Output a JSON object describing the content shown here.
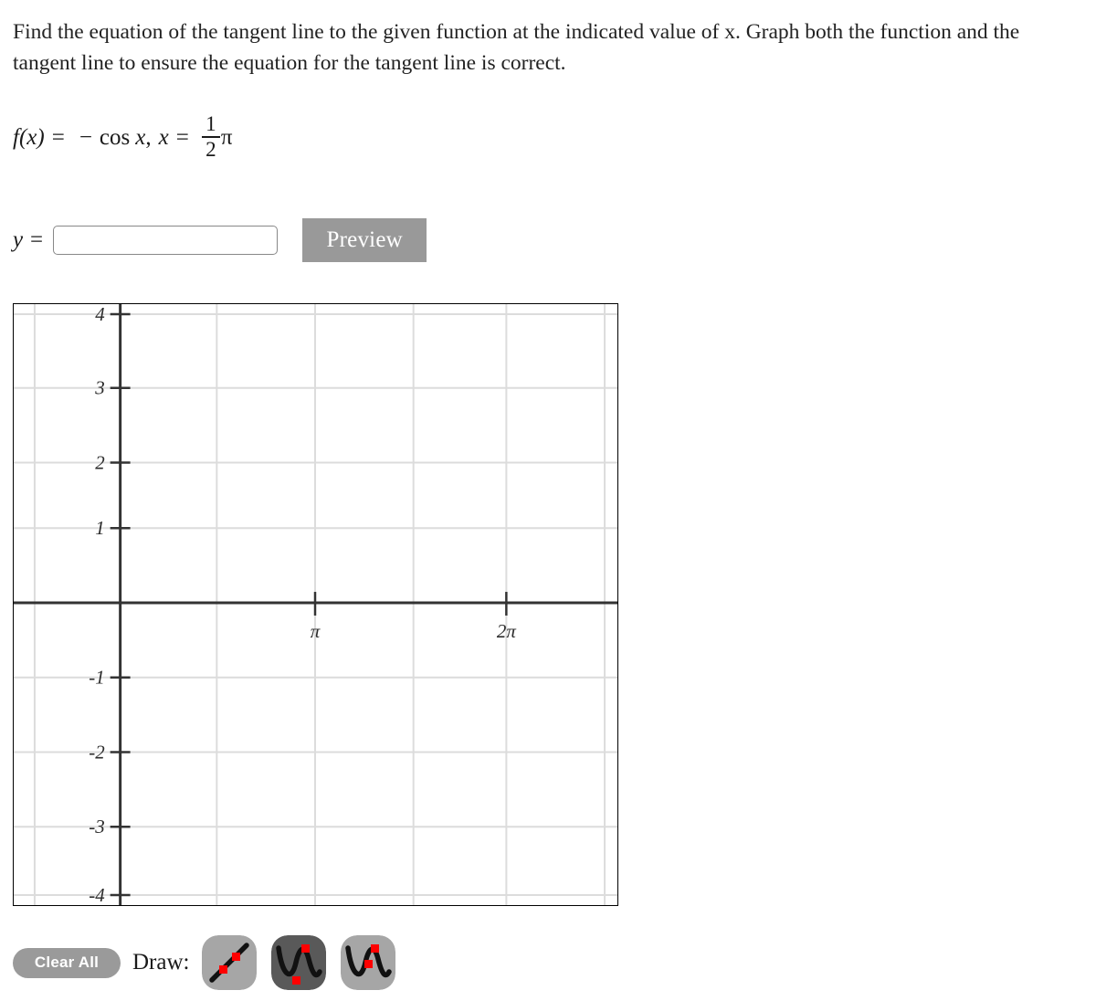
{
  "problem": {
    "statement": "Find the equation of the tangent line to the given function at the indicated value of x. Graph both the function and the tangent line to ensure the equation for the tangent line is correct.",
    "function": {
      "lhs": "f(x)",
      "equals": "=",
      "minus": "−",
      "cos": "cos",
      "cos_arg": "x",
      "comma": ",",
      "x_var": "x",
      "x_equals": "=",
      "fraction_numerator": "1",
      "fraction_denominator": "2",
      "pi": "π"
    }
  },
  "answer": {
    "label": "y =",
    "value": "",
    "placeholder": "",
    "preview_label": "Preview"
  },
  "graph": {
    "y_tick_labels": [
      "4",
      "3",
      "2",
      "1",
      "-1",
      "-2",
      "-3",
      "-4"
    ],
    "x_tick_labels": [
      "π",
      "2π"
    ],
    "axis_color": "#333333",
    "grid_color": "#d8d8d8",
    "frame_color": "#000000",
    "background": "#ffffff"
  },
  "toolbar": {
    "clear_all_label": "Clear All",
    "draw_label": "Draw:",
    "tools": [
      {
        "name": "line-tool",
        "icon": "line-two-points-icon",
        "selected": false
      },
      {
        "name": "sine-tool-selected",
        "icon": "sine-wave-peak-valley-icon",
        "selected": true
      },
      {
        "name": "sine-tool",
        "icon": "sine-wave-peak-midpoint-icon",
        "selected": false
      }
    ]
  },
  "chart_data": {
    "type": "line",
    "title": "",
    "xlabel": "",
    "ylabel": "",
    "xlim": [
      -1.2,
      7.8
    ],
    "ylim": [
      -4.2,
      4.2
    ],
    "x_ticks": [
      3.14159,
      6.28318
    ],
    "x_tick_labels": [
      "π",
      "2π"
    ],
    "y_ticks": [
      4,
      3,
      2,
      1,
      -1,
      -2,
      -3,
      -4
    ],
    "y_tick_labels": [
      "4",
      "3",
      "2",
      "1",
      "-1",
      "-2",
      "-3",
      "-4"
    ],
    "grid": true,
    "legend": "none",
    "series": []
  }
}
